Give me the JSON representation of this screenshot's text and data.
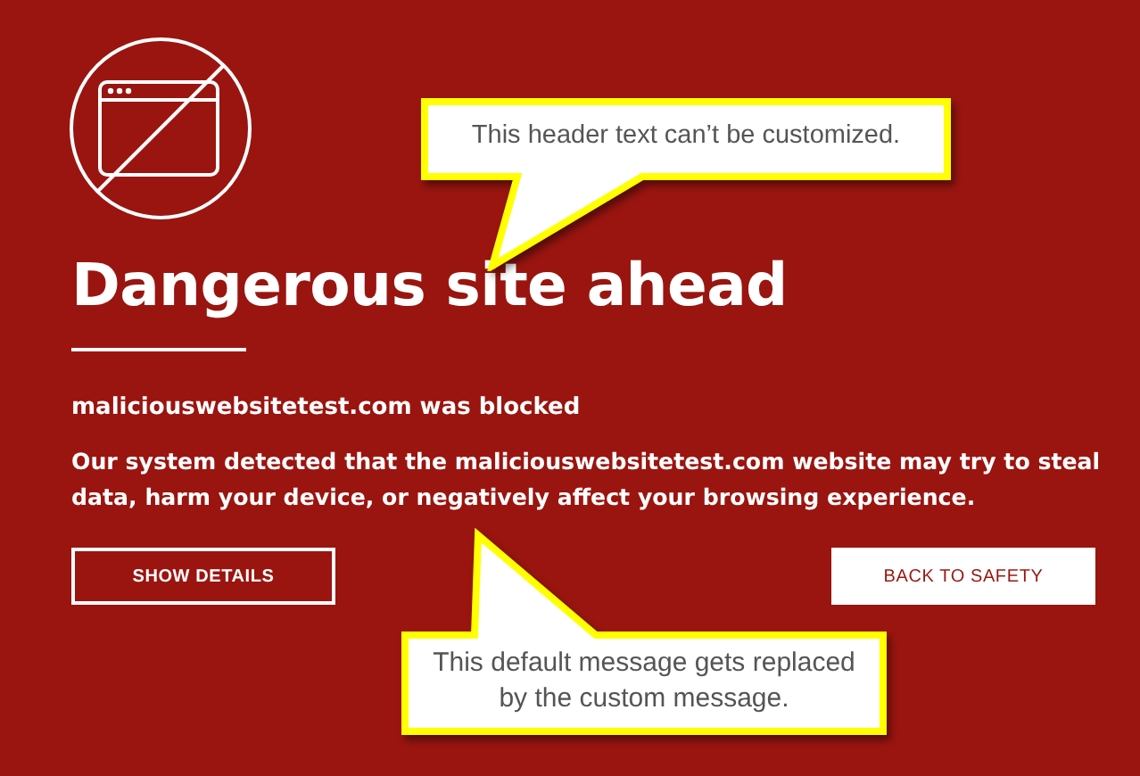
{
  "heading": "Dangerous site ahead",
  "blocked_title": "maliciouswebsitetest.com was blocked",
  "message": "Our system detected that the maliciouswebsitetest.com website may try to steal data, harm your device, or negatively affect your browsing experience.",
  "buttons": [
    {
      "label": "SHOW DETAILS",
      "kind": "outline"
    },
    {
      "label": "BACK TO SAFETY",
      "kind": "solid"
    }
  ],
  "callouts": [
    {
      "text": "This header text can’t be customized.",
      "kind": "down"
    },
    {
      "text": "This default message gets replaced by the custom message.",
      "kind": "up"
    }
  ]
}
